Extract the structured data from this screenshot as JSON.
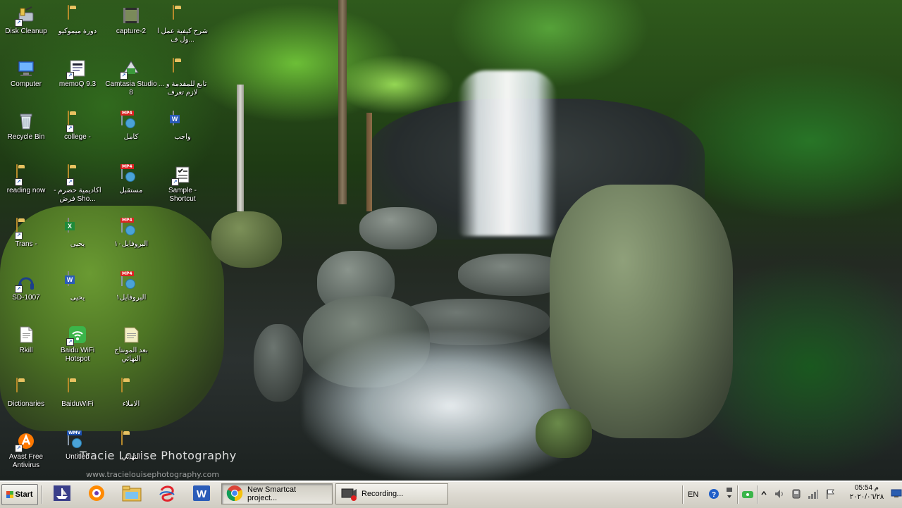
{
  "desktop": {
    "icons": [
      {
        "label": "Disk Cleanup",
        "icon": "disk-cleanup-icon"
      },
      {
        "label": "دورة ميموكيو",
        "icon": "folder-icon"
      },
      {
        "label": "capture-2",
        "icon": "video-clip-icon"
      },
      {
        "label": "شرح كيفية عمل ا ول ف...",
        "icon": "folder-icon"
      },
      {
        "label": "Computer",
        "icon": "computer-icon"
      },
      {
        "label": "memoQ 9.3",
        "icon": "memoq-icon"
      },
      {
        "label": "Camtasia Studio 8",
        "icon": "camtasia-icon"
      },
      {
        "label": "تابع للمقدمة و ... لازم تعرف",
        "icon": "folder-icon"
      },
      {
        "label": "Recycle Bin",
        "icon": "recycle-bin-icon"
      },
      {
        "label": "college -",
        "icon": "folder-icon"
      },
      {
        "label": "كامل",
        "icon": "mp4-file-icon"
      },
      {
        "label": "واجب",
        "icon": "word-document-icon"
      },
      {
        "label": "reading now",
        "icon": "folder-icon"
      },
      {
        "label": "اكاديمية حضرم - فرض Sho...",
        "icon": "folder-icon"
      },
      {
        "label": "مستقبل",
        "icon": "mp4-file-icon"
      },
      {
        "label": "Sample - Shortcut",
        "icon": "checklist-shortcut-icon"
      },
      {
        "label": "Trans -",
        "icon": "folder-icon"
      },
      {
        "label": "يحيى",
        "icon": "excel-document-icon"
      },
      {
        "label": "البروفايل١٠",
        "icon": "mp4-file-icon"
      },
      {
        "label": "SD-1007",
        "icon": "headphones-icon"
      },
      {
        "label": "يحيى",
        "icon": "word-document-icon"
      },
      {
        "label": "البروفايل١",
        "icon": "mp4-file-icon"
      },
      {
        "label": "Rkill",
        "icon": "text-file-icon"
      },
      {
        "label": "Baidu WiFi Hotspot",
        "icon": "wifi-hotspot-icon"
      },
      {
        "label": "بعد المونتاج النهائي",
        "icon": "notepad-file-icon"
      },
      {
        "label": "Dictionaries",
        "icon": "folder-icon"
      },
      {
        "label": "BaiduWiFi",
        "icon": "folder-icon"
      },
      {
        "label": "الاملاء",
        "icon": "folder-icon"
      },
      {
        "label": "Avast Free Antivirus",
        "icon": "avast-icon"
      },
      {
        "label": "Untitled",
        "icon": "wmv-file-icon"
      },
      {
        "label": "النهائي",
        "icon": "folder-icon"
      }
    ],
    "watermark": "Tracie Louise Photography",
    "watermark_url": "www.tracielouisephotography.com"
  },
  "taskbar": {
    "start_label": "Start",
    "quicklaunch": [
      "boat-app-icon",
      "avast-tray-app-icon",
      "folder-explorer-icon",
      "swirl-app-icon",
      "word-app-icon"
    ],
    "tasks": [
      {
        "label": "New Smartcat project...",
        "icon": "chrome-icon",
        "active": true
      },
      {
        "label": "Recording...",
        "icon": "camtasia-recorder-icon",
        "active": false
      }
    ],
    "language": "EN",
    "clock_time": "05:54 م",
    "clock_date": "٢٠٢٠/٠٦/٢٨"
  },
  "colors": {
    "taskbar_bg": "#dcd9d0",
    "label_text": "#ffffff"
  }
}
